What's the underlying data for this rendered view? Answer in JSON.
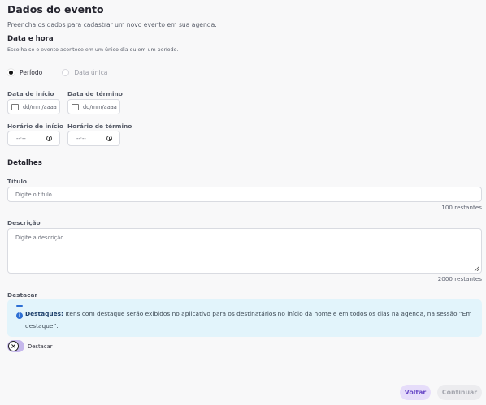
{
  "page": {
    "title": "Dados do evento",
    "subtitle": "Preencha os dados para cadastrar um novo evento em sua agenda."
  },
  "date_section": {
    "title": "Data e hora",
    "hint": "Escolha se o evento acontece em um único dia ou em um período.",
    "options": [
      {
        "label": "Período",
        "selected": true
      },
      {
        "label": "Data única",
        "selected": false
      }
    ],
    "start_date_label": "Data de início",
    "end_date_label": "Data de término",
    "date_placeholder": "dd/mm/aaaa",
    "start_time_label": "Horário de início",
    "end_time_label": "Horário de término",
    "time_placeholder": "--:--"
  },
  "details": {
    "title": "Detalhes",
    "title_label": "Título",
    "title_placeholder": "Digite o título",
    "title_remaining": "100 restantes",
    "description_label": "Descrição",
    "description_placeholder": "Digite a descrição",
    "description_remaining": "2000 restantes"
  },
  "highlight": {
    "label": "Destacar",
    "info_bold": "Destaques:",
    "info_text": " Itens com destaque serão exibidos no aplicativo para os destinatários no início da home e em todos os dias na agenda, na sessão “Em destaque”.",
    "toggle_label": "Destacar",
    "toggle_on": false
  },
  "footer": {
    "back_label": "Voltar",
    "continue_label": "Continuar"
  },
  "colors": {
    "accent": "#6a4bc7",
    "accent_bg": "#e6ddfa",
    "info_bg": "#e2f4fb",
    "info_icon": "#2d6fd4"
  }
}
